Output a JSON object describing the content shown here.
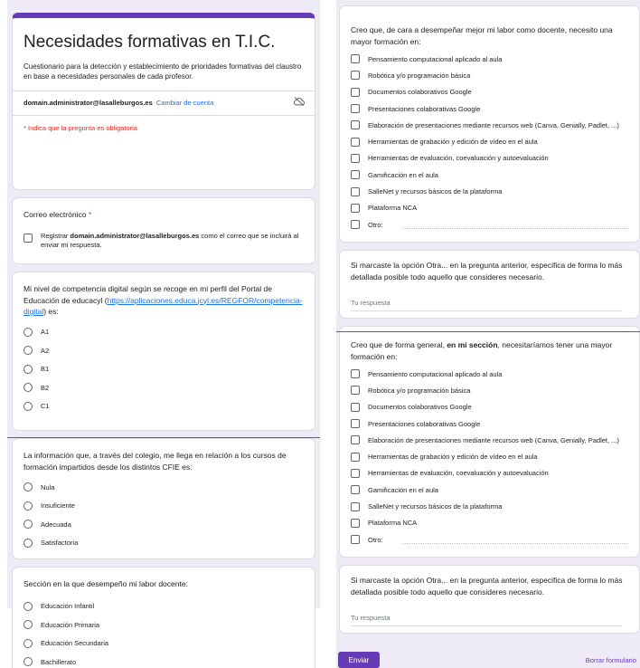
{
  "header": {
    "title": "Necesidades formativas en T.I.C.",
    "description": "Cuestionario para la detección y establecimiento de prioridades formativas del claustro en base a necesidades personales de cada profesor.",
    "account_email": "domain.administrator@lasalleburgos.es",
    "switch_account": "Cambiar de cuenta",
    "required_note": "* Indica que la pregunta es obligatoria",
    "cloud_icon": "cloud-off-icon"
  },
  "email_question": {
    "label": "Correo electrónico",
    "required_mark": "*",
    "option_prefix": "Registrar",
    "option_email": "domain.administrator@lasalleburgos.es",
    "option_suffix": "como el correo que se incluirá al enviar mi respuesta."
  },
  "competence_question": {
    "text_before": "Mi nivel de competencia digital según se recoge en mi perfil del Portal de Educación de educacyl (",
    "link": "https://aplicaciones.educa.jcyl.es/REGFOR/competencia-digital",
    "text_after": ") es:",
    "options": [
      "A1",
      "A2",
      "B1",
      "B2",
      "C1"
    ]
  },
  "info_question": {
    "text": "La información que, a través del colegio, me llega en relación a los cursos de formación impartidos desde los distintos CFIE es:",
    "options": [
      "Nula",
      "Insuficiente",
      "Adecuada",
      "Satisfactoria"
    ]
  },
  "section_question": {
    "text": "Sección en la que desempeño mi labor docente:",
    "options": [
      "Educación Infantil",
      "Educación Primaria",
      "Educación Secundaria",
      "Bachillerato"
    ]
  },
  "personal_needs": {
    "text": "Creo que, de cara a desempeñar mejor mi labor como docente, necesito una mayor formación en:",
    "options": [
      "Pensamiento computacional aplicado al aula",
      "Robótica y/o programación básica",
      "Documentos colaborativos Google",
      "Presentaciones colaborativas Google",
      "Elaboración de presentaciones mediante recursos web (Canva, Genially, Padlet, ...)",
      "Herramientas de grabación y edición de vídeo en el aula",
      "Herramientas de evaluación, coevaluación y autoevaluación",
      "Gamificación en el aula",
      "SalleNet y recursos básicos de la plataforma",
      "Plataforma NCA"
    ],
    "other_label": "Otro:"
  },
  "personal_other": {
    "text": "Si marcaste la opción Otra... en la pregunta anterior, especifica de forma lo más detallada posible todo aquello que consideres necesario.",
    "placeholder": "Tu respuesta"
  },
  "section_needs": {
    "text_before": "Creo que de forma general, ",
    "text_bold": "en mi sección",
    "text_after": ", necesitaríamos tener una mayor formación en:",
    "options": [
      "Pensamiento computacional aplicado al aula",
      "Robótica y/o programación básica",
      "Documentos colaborativos Google",
      "Presentaciones colaborativas Google",
      "Elaboración de presentaciones mediante recursos web (Canva, Genially, Padlet, ...)",
      "Herramientas de grabación y edición de vídeo en el aula",
      "Herramientas de evaluación, coevaluación y autoevaluación",
      "Gamificación en el aula",
      "SalleNet y recursos básicos de la plataforma",
      "Plataforma NCA"
    ],
    "other_label": "Otro:"
  },
  "section_other": {
    "text": "Si marcaste la opción Otra... en la pregunta anterior, especifica de forma lo más detallada posible todo aquello que consideres necesario.",
    "placeholder": "Tu respuesta"
  },
  "footer": {
    "submit": "Enviar",
    "clear": "Borrar formulario"
  },
  "colors": {
    "accent": "#673ab7",
    "background": "#eeebf6",
    "required": "#d93025",
    "link": "#1a73e8"
  }
}
